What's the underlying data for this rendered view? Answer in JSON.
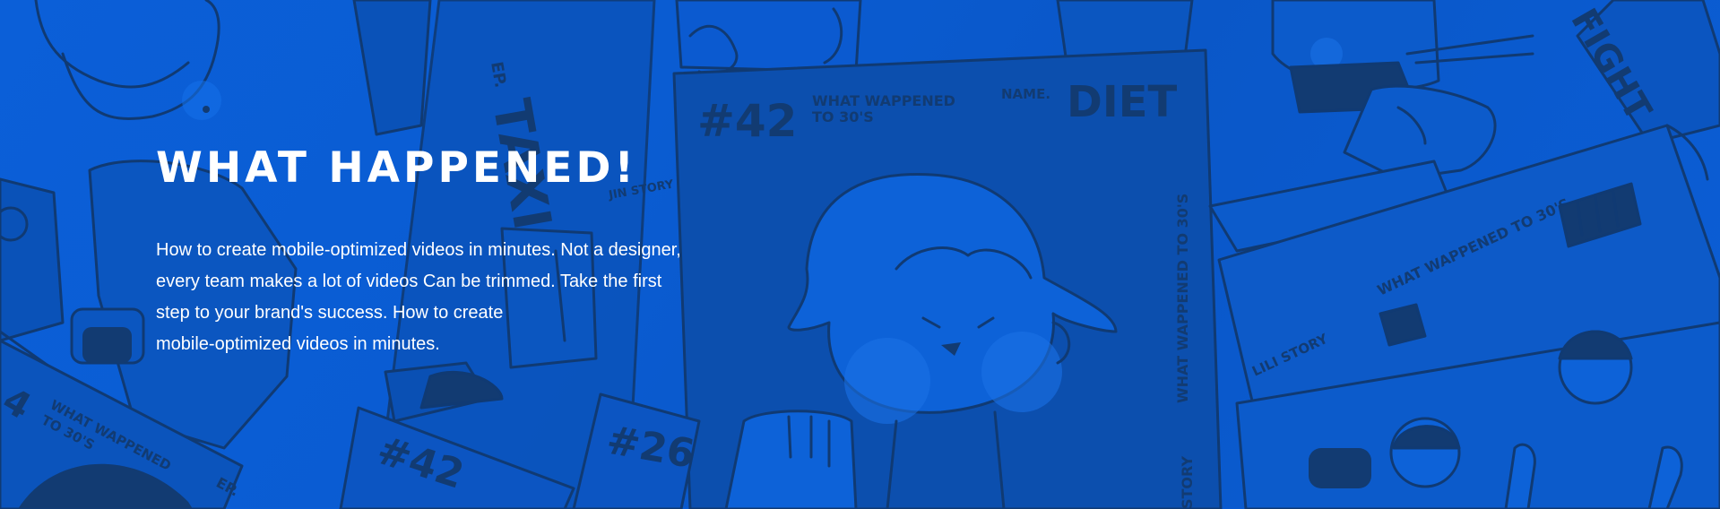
{
  "hero": {
    "title": "WHAT HAPPENED!",
    "description_lines": [
      "How to create mobile-optimized videos in minutes. Not a designer,",
      "every team makes a lot of videos Can be trimmed. Take the first",
      "step to your brand's success. How to create",
      "mobile-optimized videos in minutes."
    ]
  },
  "background_art": {
    "poster_main": {
      "number": "#42",
      "subtitle_line1": "WHAT WAPPENED",
      "subtitle_line2": "TO 30'S",
      "name_label": "NAME.",
      "name_value": "DIET",
      "side_text": "WHAT WAPPENED TO 30'S",
      "bottom_side_text": "STORY"
    },
    "poster_taxi": {
      "ep_label": "EP.",
      "word": "TAXI",
      "small_text": "JIN STORY"
    },
    "poster_fight": {
      "word": "FIGHT"
    },
    "ribbon_right": {
      "title": "WHAT WAPPENED TO 30'S",
      "small": "LILI STORY"
    },
    "poster_bottom_left": {
      "number": "4",
      "text_line1": "WHAT WAPPENED",
      "text_line2": "TO 30'S",
      "ep_label": "EP."
    },
    "poster_bottom_mid1": {
      "number": "#42"
    },
    "poster_bottom_mid2": {
      "number": "#26"
    }
  },
  "colors": {
    "background": "#0a5fd6",
    "art_dark": "#103a73",
    "art_mid": "#0b4fb0",
    "art_light": "#1470e8",
    "text": "#ffffff"
  }
}
